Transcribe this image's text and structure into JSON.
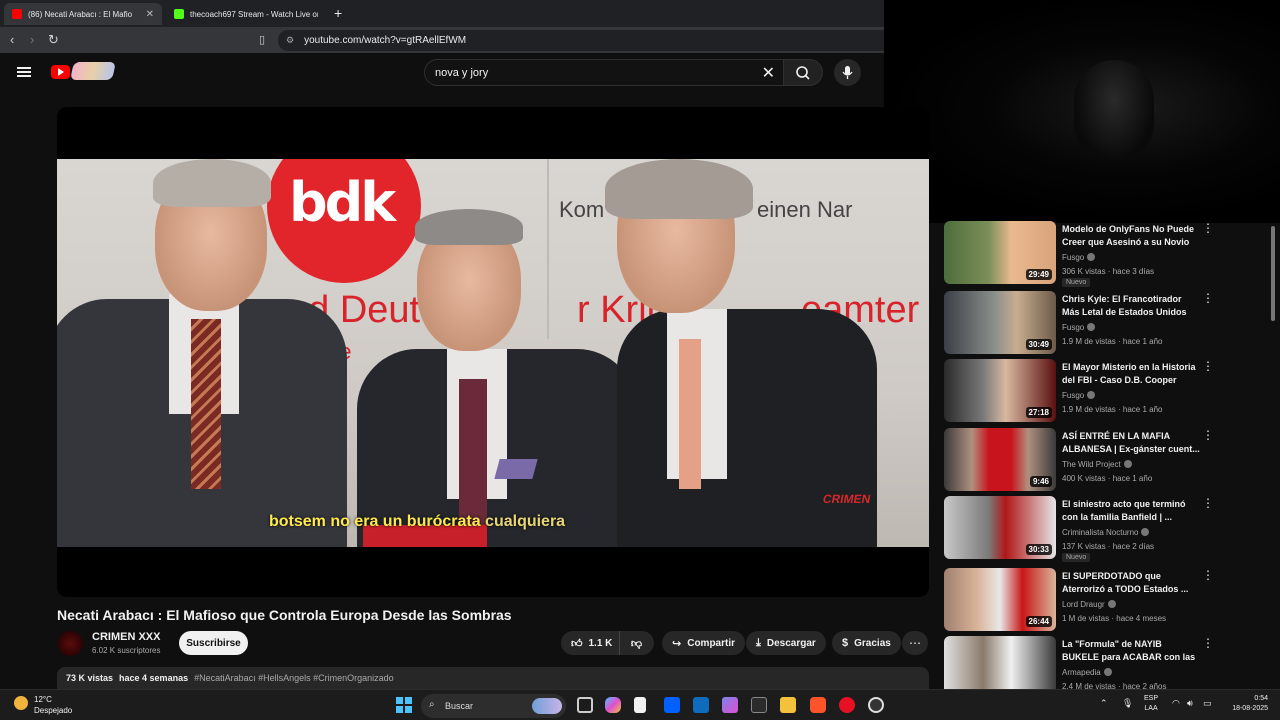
{
  "browser": {
    "tabs": [
      {
        "title": "(86) Necati Arabacı : El Mafio",
        "active": true,
        "favicon_color": "#ff0000"
      },
      {
        "title": "thecoach697 Stream - Watch Live on",
        "active": false,
        "favicon_color": "#53fc18"
      }
    ],
    "new_tab_label": "+",
    "url": "youtube.com/watch?v=gtRAellEfWM"
  },
  "youtube": {
    "search_value": "nova y jory",
    "video": {
      "title": "Necati Arabacı : El Mafioso que Controla Europa Desde las Sombras",
      "subtitle_main": "botsem no era un burócrata",
      "subtitle_tail": "cualquiera",
      "scene_text": {
        "logo": "bdk",
        "banner": "nd Deut",
        "banner_mid": "r Krim",
        "banner_end": "eamter",
        "banner_small": "de",
        "kom": "Kom",
        "kom_end": "einen Nar",
        "watermark": "CRIMEN"
      }
    },
    "channel": {
      "name": "CRIMEN XXX",
      "subscribers": "6.02 K suscriptores",
      "subscribe_label": "Suscribirse"
    },
    "actions": {
      "likes": "1.1 K",
      "share": "Compartir",
      "download": "Descargar",
      "thanks": "Gracias"
    },
    "description": {
      "views": "73 K vistas",
      "age": "hace 4 semanas",
      "tags": "#NecatiArabacı #HellsAngels #CrimenOrganizado"
    },
    "recommendations": [
      {
        "title": "Modelo de OnlyFans No Puede Creer que Asesinó a su Novio",
        "channel": "Fusgo",
        "meta": "306 K vistas · hace 3 días",
        "duration": "29:49",
        "badge": "Nuevo"
      },
      {
        "title": "Chris Kyle: El Francotirador Más Letal de Estados Unidos",
        "channel": "Fusgo",
        "meta": "1.9 M de vistas · hace 1 año",
        "duration": "30:49",
        "badge": ""
      },
      {
        "title": "El Mayor Misterio en la Historia del FBI - Caso D.B. Cooper",
        "channel": "Fusgo",
        "meta": "1.9 M de vistas · hace 1 año",
        "duration": "27:18",
        "badge": ""
      },
      {
        "title": "ASÍ ENTRÉ EN LA MAFIA ALBANESA | Ex-gánster cuent...",
        "channel": "The Wild Project",
        "meta": "400 K vistas · hace 1 año",
        "duration": "9:46",
        "badge": ""
      },
      {
        "title": "El siniestro acto que terminó con la familia Banfield | ...",
        "channel": "Criminalista Nocturno",
        "meta": "137 K vistas · hace 2 días",
        "duration": "30:33",
        "badge": "Nuevo"
      },
      {
        "title": "El SUPERDOTADO que Aterrorizó a TODO Estados ...",
        "channel": "Lord Draugr",
        "meta": "1 M de vistas · hace 4 meses",
        "duration": "26:44",
        "badge": ""
      },
      {
        "title": "La \"Formula\" de NAYIB BUKELE para ACABAR con las ...",
        "channel": "Armapedia",
        "meta": "2.4 M de vistas · hace 2 años",
        "duration": "",
        "badge": ""
      }
    ]
  },
  "taskbar": {
    "temperature": "12°C",
    "condition": "Despejado",
    "search_label": "Buscar",
    "lang_top": "ESP",
    "lang_bottom": "LAA",
    "time": "0:54",
    "date": "18-08-2025"
  },
  "colors": {
    "youtube_red": "#ff0000",
    "subtitle_yellow": "#ffe94d",
    "background": "#0f0f0f"
  }
}
